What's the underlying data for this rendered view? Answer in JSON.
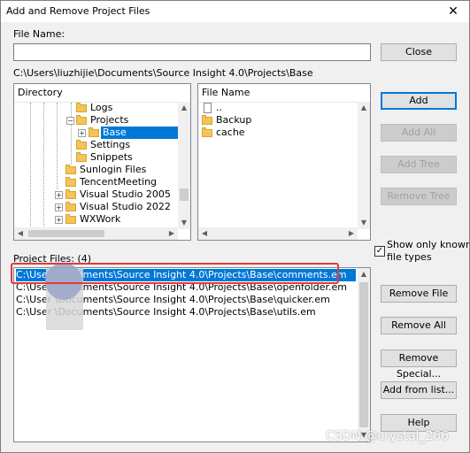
{
  "window": {
    "title": "Add and Remove Project Files"
  },
  "file_name": {
    "label": "File Name:",
    "value": ""
  },
  "path_display": "C:\\Users\\liuzhijie\\Documents\\Source Insight 4.0\\Projects\\Base",
  "directory_panel": {
    "header": "Directory",
    "items": [
      {
        "label": "Logs",
        "selected": false
      },
      {
        "label": "Projects",
        "selected": false
      },
      {
        "label": "Base",
        "selected": true
      },
      {
        "label": "Settings",
        "selected": false
      },
      {
        "label": "Snippets",
        "selected": false
      },
      {
        "label": "Sunlogin Files",
        "selected": false
      },
      {
        "label": "TencentMeeting",
        "selected": false
      },
      {
        "label": "Visual Studio 2005",
        "selected": false
      },
      {
        "label": "Visual Studio 2022",
        "selected": false
      },
      {
        "label": "WXWork",
        "selected": false
      }
    ]
  },
  "file_panel": {
    "header": "File Name",
    "items": [
      {
        "label": "..",
        "type": "doc"
      },
      {
        "label": "Backup",
        "type": "folder"
      },
      {
        "label": "cache",
        "type": "folder"
      }
    ]
  },
  "buttons": {
    "close": "Close",
    "add": "Add",
    "add_all": "Add All",
    "add_tree": "Add Tree",
    "remove_tree": "Remove Tree",
    "remove_file": "Remove File",
    "remove_all": "Remove All",
    "remove_special": "Remove Special...",
    "add_from_list": "Add from list...",
    "help": "Help"
  },
  "show_known_types": {
    "label_line1": "Show only known",
    "label_line2": "file types",
    "checked": true
  },
  "project_files": {
    "label": "Project Files: (4)",
    "rows": [
      {
        "text": "C:\\Users\\liuzhijie\\Documents\\Source Insight 4.0\\Projects\\Base\\comments.em",
        "shown": "C:\\User              \\Documents\\Source Insight 4.0\\Projects\\Base\\comments.em",
        "selected": true
      },
      {
        "text": "C:\\Users\\liuzhijie\\Documents\\Source Insight 4.0\\Projects\\Base\\openfolder.em",
        "shown": "C:\\User              \\Documents\\Source Insight 4.0\\Projects\\Base\\openfolder.em",
        "selected": false
      },
      {
        "text": "C:\\Users\\liuzhijie\\Documents\\Source Insight 4.0\\Projects\\Base\\quicker.em",
        "shown": "C:\\User              \\Documents\\Source Insight 4.0\\Projects\\Base\\quicker.em",
        "selected": false
      },
      {
        "text": "C:\\Users\\liuzhijie\\Documents\\Source Insight 4.0\\Projects\\Base\\utils.em",
        "shown": "C:\\User              \\Documents\\Source Insight 4.0\\Projects\\Base\\utils.em",
        "selected": false
      }
    ]
  },
  "watermark": "CSDN @crystal_266",
  "colors": {
    "selection": "#0078d7",
    "highlight_box": "#e53935",
    "default_button_border": "#0078d7"
  }
}
